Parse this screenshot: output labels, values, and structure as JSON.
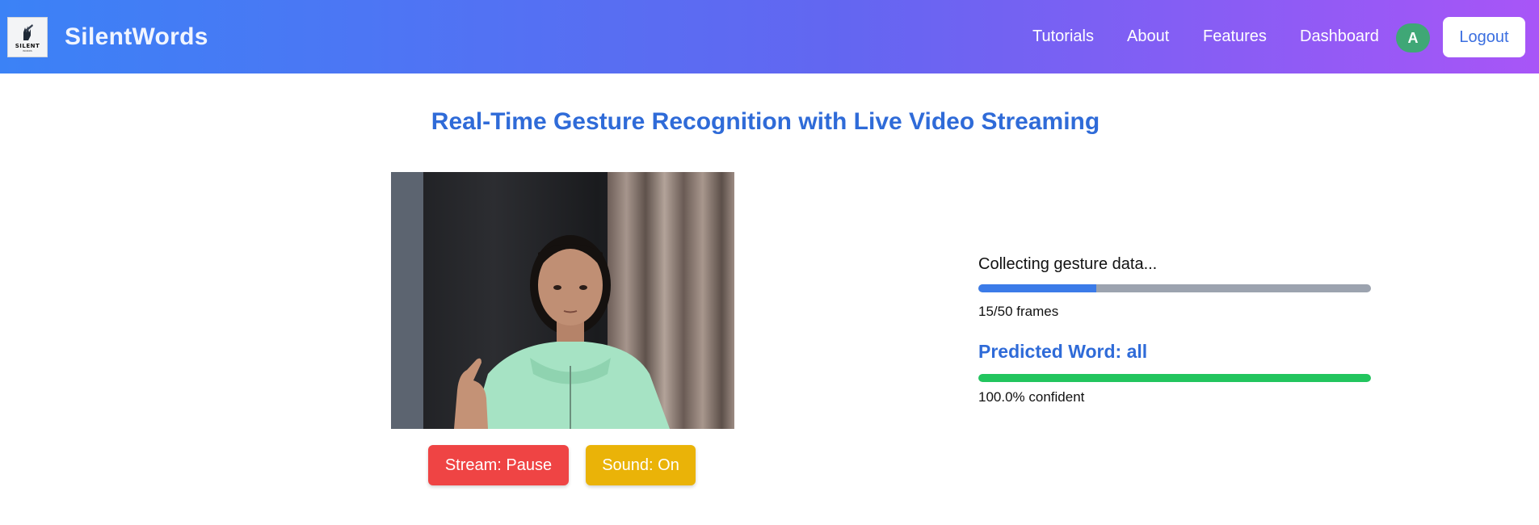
{
  "brand": {
    "logo_text": "SILENT",
    "logo_subtext": "WORDS",
    "name": "SilentWords"
  },
  "nav": {
    "links": [
      "Tutorials",
      "About",
      "Features",
      "Dashboard"
    ],
    "avatar_initial": "A",
    "logout_label": "Logout"
  },
  "main": {
    "title": "Real-Time Gesture Recognition with Live Video Streaming",
    "controls": {
      "stream_label": "Stream: Pause",
      "sound_label": "Sound: On"
    },
    "status": {
      "message": "Collecting gesture data...",
      "frames_collected": 15,
      "frames_total": 50,
      "frames_text": "15/50 frames",
      "predicted_label": "Predicted Word: all",
      "confidence_percent": 100,
      "confidence_text": "100.0% confident"
    }
  },
  "colors": {
    "nav_gradient_start": "#3b82f6",
    "nav_gradient_end": "#a855f7",
    "title": "#2f6bd8",
    "stream_button": "#ef4444",
    "sound_button": "#eab308",
    "progress_fill": "#3b7be8",
    "confidence_fill": "#22c55e",
    "avatar": "#3fa776"
  },
  "icons": {
    "logo": "hand-sign-logo-icon"
  }
}
